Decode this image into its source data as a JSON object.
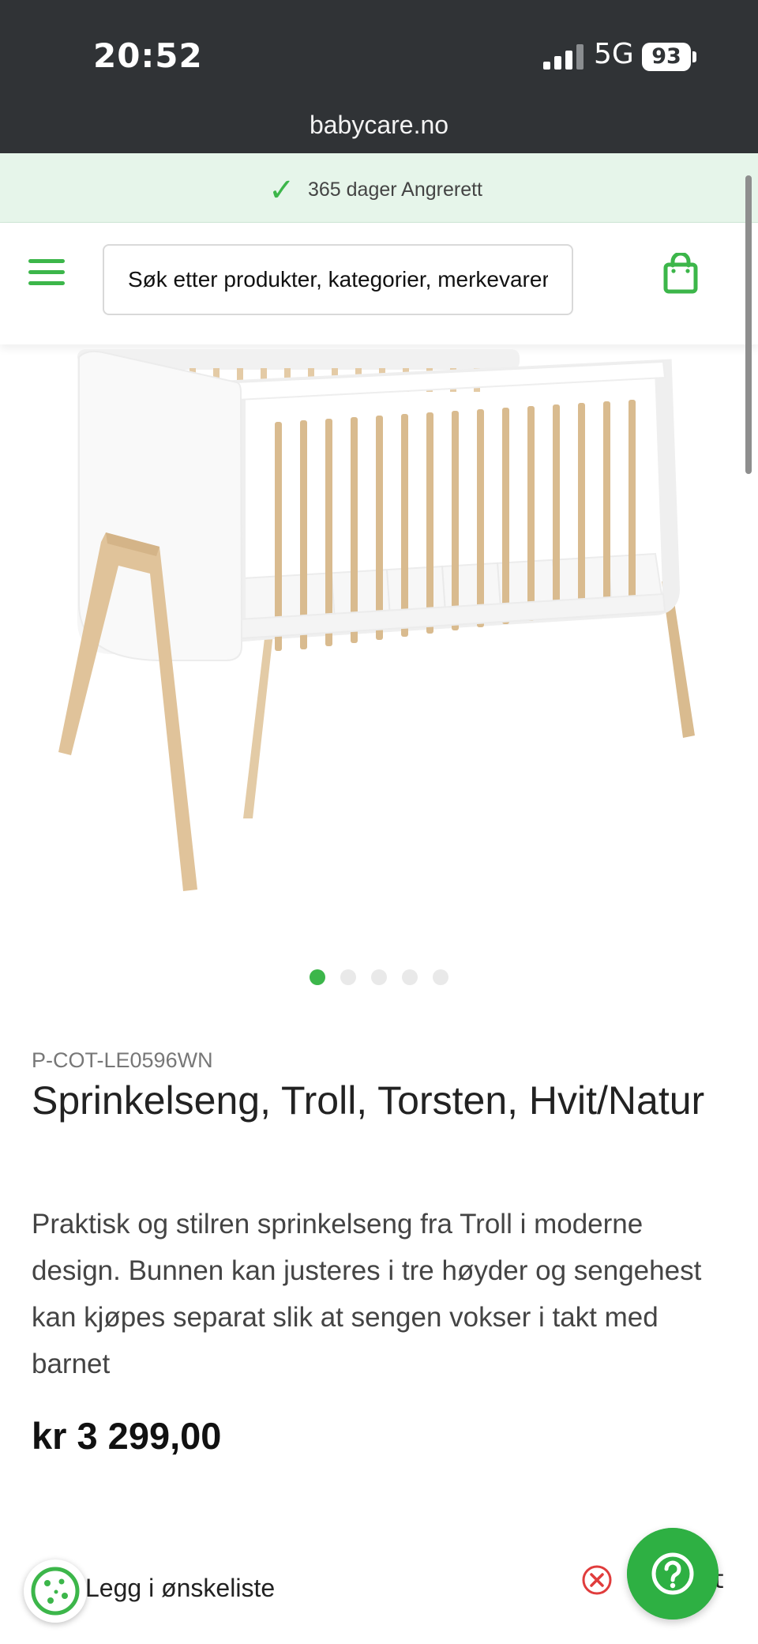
{
  "status_bar": {
    "time": "20:52",
    "network": "5G",
    "battery": "93"
  },
  "browser": {
    "url": "babycare.no"
  },
  "promo_banner": {
    "text": "365 dager Angrerett",
    "accent_color": "#3cb64a"
  },
  "header": {
    "menu_icon": "hamburger-menu-icon",
    "search_placeholder": "Søk etter produkter, kategorier, merkevarer",
    "cart_icon": "shopping-bag-icon"
  },
  "gallery": {
    "total_images": 5,
    "active_index": 0
  },
  "product": {
    "sku": "P-COT-LE0596WN",
    "title": "Sprinkelseng, Troll, Torsten, Hvit/Natur",
    "description": "Praktisk og stilren sprinkelseng fra Troll i moderne design. Bunnen kan justeres i tre høyder og sengehest kan kjøpes separat slik at sengen vokser i takt med barnet",
    "price": "kr 3 299,00"
  },
  "bottom": {
    "wishlist_label": "Legg i ønskeliste",
    "help_peek": "t",
    "help_color": "#2eb043"
  }
}
